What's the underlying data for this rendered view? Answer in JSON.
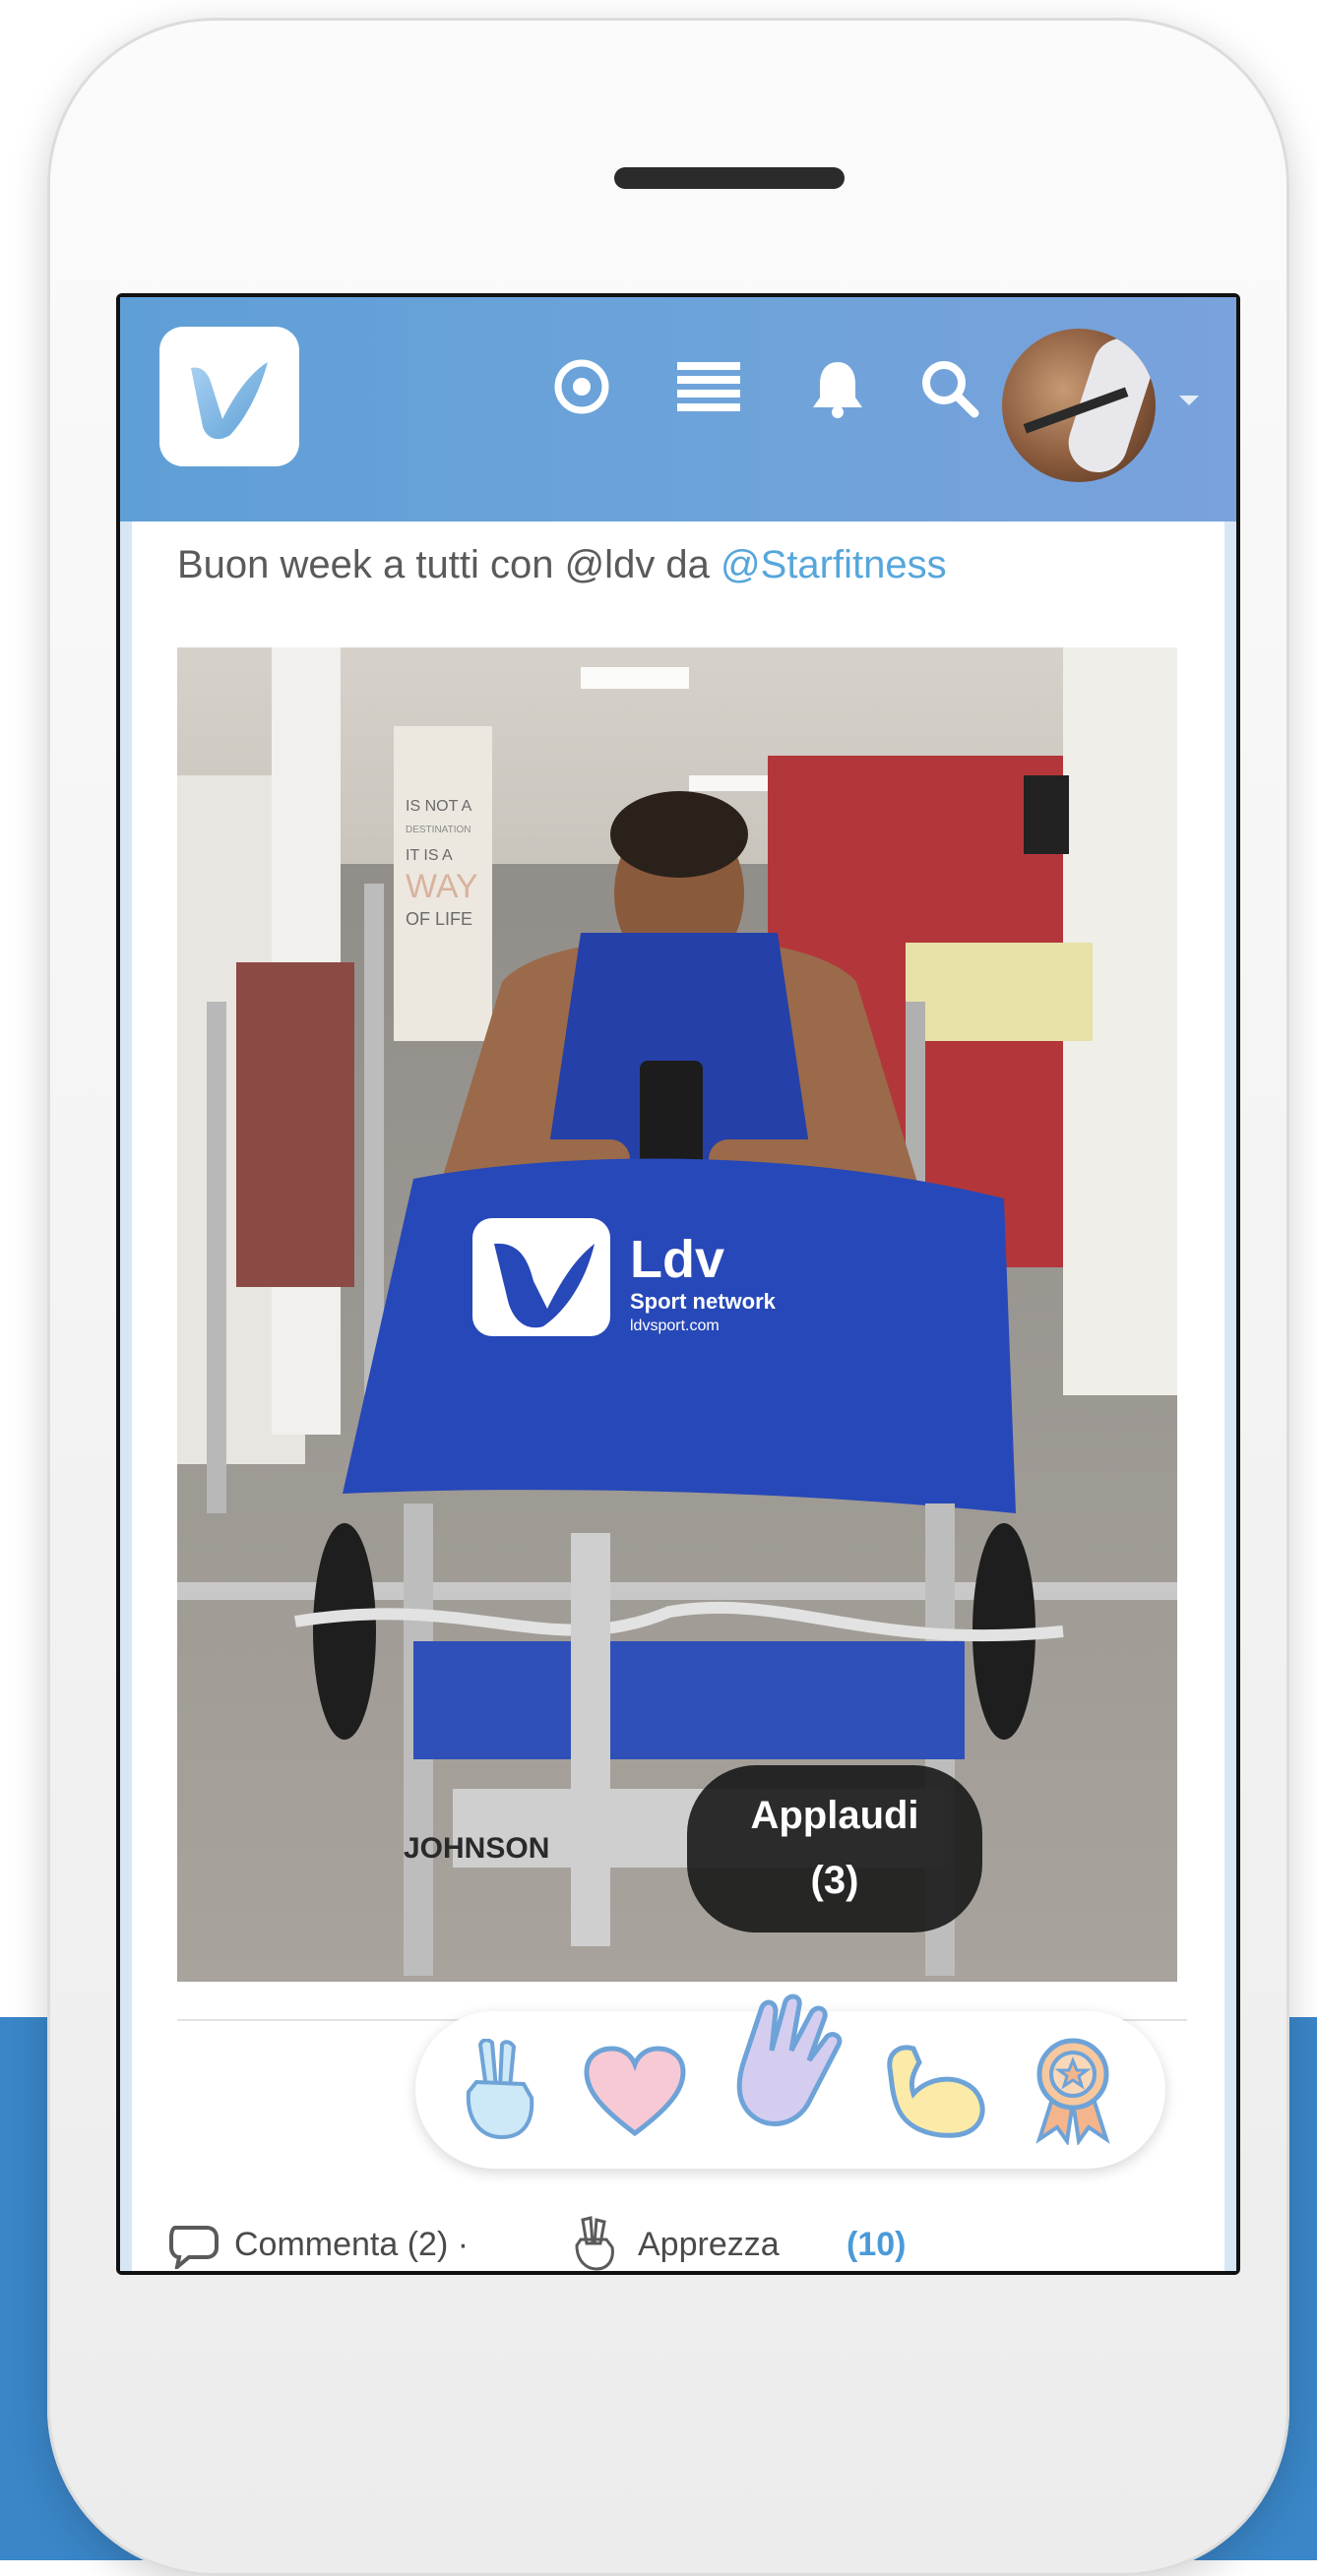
{
  "post": {
    "text_before": "Buon week a tutti con @ldv da ",
    "mention": "@Starfitness"
  },
  "tooltip": {
    "label": "Applaudi",
    "count": "(3)"
  },
  "actions": {
    "comment_label": "Commenta (2) ·",
    "appreciate_label": "Apprezza",
    "appreciate_count": "(10)"
  },
  "photo_scene": {
    "poster": [
      "IS NOT A",
      "DESTINATION",
      "IT IS A",
      "WAY",
      "OF LIFE"
    ],
    "towel_brand": "Ldv",
    "towel_tagline": "Sport network",
    "towel_url": "ldvsport.com",
    "bench_brand": "JOHNSON"
  },
  "icons": {
    "header": [
      "target-icon",
      "list-icon",
      "bell-icon",
      "search-icon"
    ],
    "reactions": [
      "peace-hand-icon",
      "heart-icon",
      "clap-icon",
      "muscle-icon",
      "medal-icon"
    ]
  },
  "colors": {
    "header_gradient_start": "#5e9fd6",
    "header_gradient_end": "#7aa2dc",
    "mention": "#56a6dc",
    "background_band": "#3a86c8"
  }
}
